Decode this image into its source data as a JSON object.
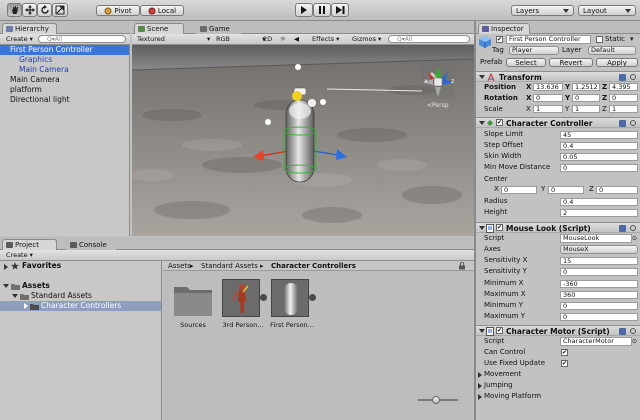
{
  "toolbar": {
    "pivot_label": "Pivot",
    "local_label": "Local",
    "layers_label": "Layers",
    "layout_label": "Layout"
  },
  "hierarchy": {
    "tab_label": "Hierarchy",
    "create_label": "Create",
    "search_placeholder": "Q▾All",
    "items": [
      {
        "label": "First Person Controller"
      },
      {
        "label": "Graphics"
      },
      {
        "label": "Main Camera"
      },
      {
        "label": "Main Camera"
      },
      {
        "label": "platform"
      },
      {
        "label": "Directional light"
      }
    ]
  },
  "scene": {
    "scene_tab": "Scene",
    "game_tab": "Game",
    "shading": "Textured",
    "channel": "RGB",
    "mode_2d": "2D",
    "effects": "Effects",
    "gizmos": "Gizmos",
    "search_placeholder": "Q▾All",
    "persp_label": "<Persp",
    "axis_x": "x",
    "axis_z": "z"
  },
  "project": {
    "project_tab": "Project",
    "console_tab": "Console",
    "create_label": "Create",
    "favorites_label": "Favorites",
    "assets_label": "Assets",
    "standard_assets_label": "Standard Assets",
    "character_controllers_label": "Character Controllers",
    "breadcrumb": [
      "Assets",
      "Standard Assets",
      "Character Controllers"
    ],
    "files": [
      {
        "name": "Sources"
      },
      {
        "name": "3rd Person..."
      },
      {
        "name": "First Person..."
      }
    ]
  },
  "inspector": {
    "tab_label": "Inspector",
    "object_name": "First Person Controller",
    "static_label": "Static",
    "tag_label": "Tag",
    "tag_value": "Player",
    "layer_label": "Layer",
    "layer_value": "Default",
    "prefab_label": "Prefab",
    "select_label": "Select",
    "revert_label": "Revert",
    "apply_label": "Apply",
    "transform": {
      "title": "Transform",
      "rows": [
        {
          "label": "Position",
          "x": "13.636",
          "y": "1.2512",
          "z": "4.395"
        },
        {
          "label": "Rotation",
          "x": "0",
          "y": "0",
          "z": "0"
        },
        {
          "label": "Scale",
          "x": "1",
          "y": "1",
          "z": "1"
        }
      ]
    },
    "character_controller": {
      "title": "Character Controller",
      "slope_limit_label": "Slope Limit",
      "slope_limit": "45",
      "step_offset_label": "Step Offset",
      "step_offset": "0.4",
      "skin_width_label": "Skin Width",
      "skin_width": "0.05",
      "min_move_label": "Min Move Distance",
      "min_move": "0",
      "center_label": "Center",
      "center": {
        "x": "0",
        "y": "0",
        "z": "0"
      },
      "radius_label": "Radius",
      "radius": "0.4",
      "height_label": "Height",
      "height": "2"
    },
    "mouse_look": {
      "title": "Mouse Look (Script)",
      "script_label": "Script",
      "script_value": "MouseLook",
      "axes_label": "Axes",
      "axes_value": "MouseX",
      "sens_x_label": "Sensitivity X",
      "sens_x": "15",
      "sens_y_label": "Sensitivity Y",
      "sens_y": "0",
      "min_x_label": "Minimum X",
      "min_x": "-360",
      "max_x_label": "Maximum X",
      "max_x": "360",
      "min_y_label": "Minimum Y",
      "min_y": "0",
      "max_y_label": "Maximum Y",
      "max_y": "0"
    },
    "character_motor": {
      "title": "Character Motor (Script)",
      "script_label": "Script",
      "script_value": "CharacterMotor",
      "can_control_label": "Can Control",
      "fixed_update_label": "Use Fixed Update",
      "movement_label": "Movement",
      "jumping_label": "Jumping",
      "moving_platform_label": "Moving Platform"
    }
  }
}
